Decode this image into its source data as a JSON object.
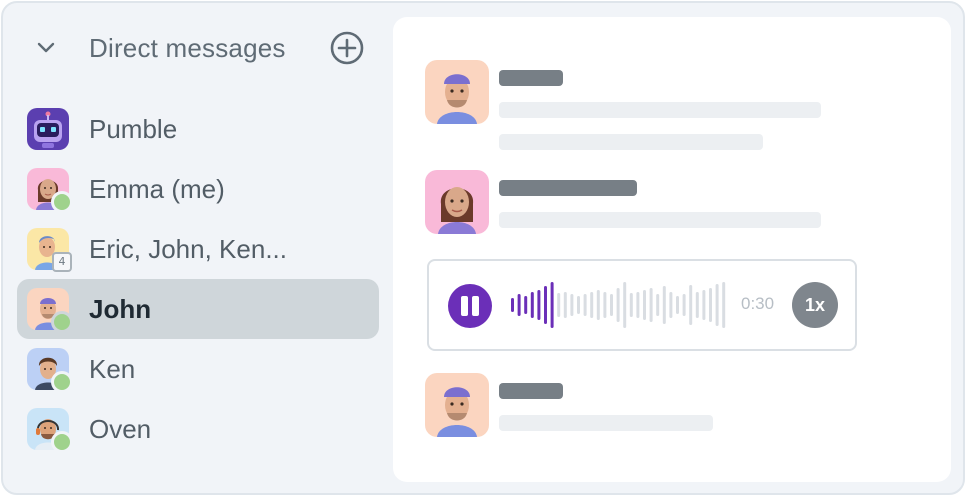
{
  "sidebar": {
    "section_title": "Direct messages",
    "collapse_icon": "chevron-down-icon",
    "add_icon": "plus-circle-icon",
    "items": [
      {
        "label": "Pumble",
        "avatar": "bot",
        "status": "none",
        "active": false
      },
      {
        "label": "Emma (me)",
        "avatar": "woman",
        "status": "online",
        "active": false
      },
      {
        "label": "Eric, John, Ken...",
        "avatar": "group",
        "status": "group",
        "member_count": "4",
        "active": false
      },
      {
        "label": "John",
        "avatar": "man-cap",
        "status": "online",
        "active": true
      },
      {
        "label": "Ken",
        "avatar": "man-blue",
        "status": "online",
        "active": false
      },
      {
        "label": "Oven",
        "avatar": "man-headset",
        "status": "online",
        "active": false
      }
    ]
  },
  "conversation": {
    "voice_message": {
      "duration": "0:30",
      "speed": "1x",
      "state": "playing",
      "progress": 0.22
    }
  },
  "colors": {
    "accent": "#6b2fb8",
    "online": "#9fd28c",
    "active_item": "#cfd6da",
    "sidebar_bg": "#f1f4f8"
  }
}
